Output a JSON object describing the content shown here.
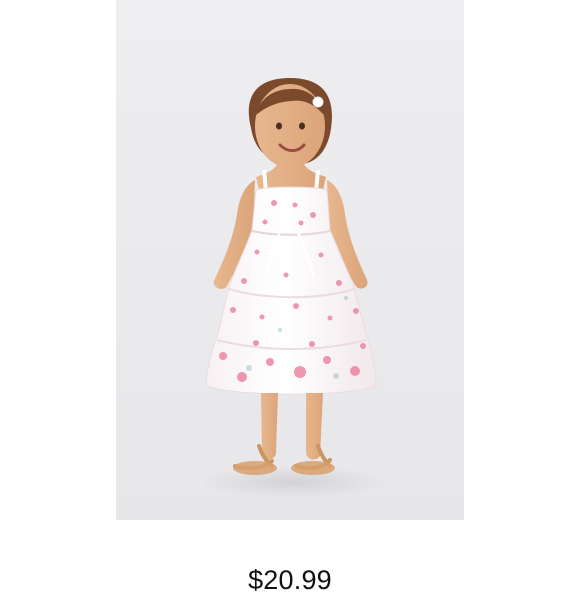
{
  "product": {
    "image_subject": "toddler-floral-sundress",
    "price": "$20.99",
    "colors": {
      "background": "#eeeef0",
      "dress": "#fbf7f8",
      "floral_print": "#ea7c9b",
      "sandals": "#c99562",
      "hair": "#7b4a2d"
    }
  }
}
